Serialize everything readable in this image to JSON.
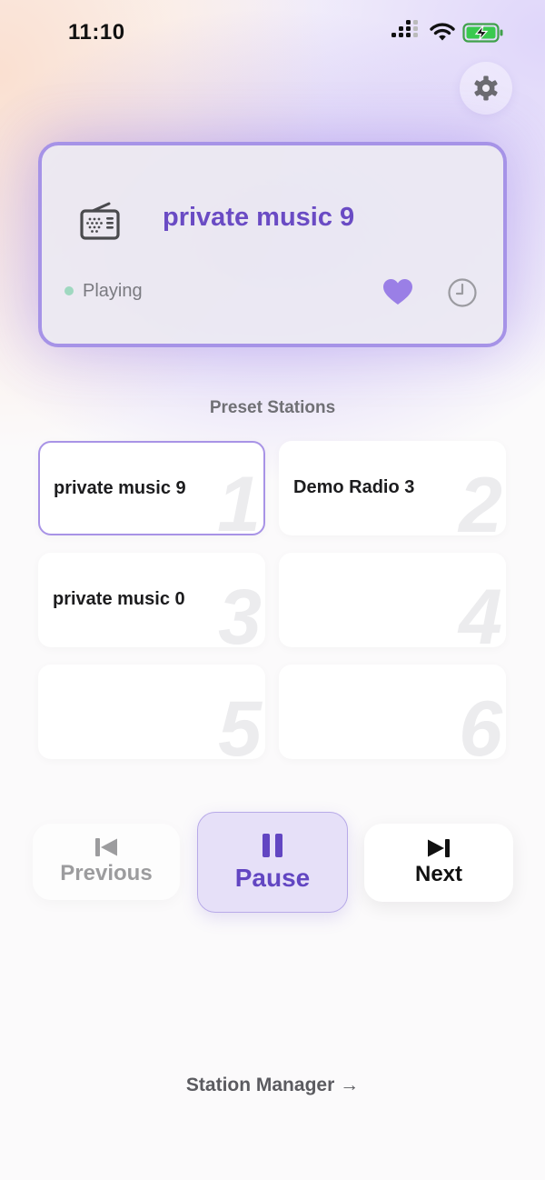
{
  "status_bar": {
    "time": "11:10"
  },
  "now_playing": {
    "station": "private music 9",
    "status": "Playing",
    "status_color": "#9fd8c0",
    "accent_color": "#6a4bc4",
    "icons": [
      "radio-icon",
      "heart-icon",
      "history-icon"
    ]
  },
  "presets": {
    "heading": "Preset Stations",
    "items": [
      {
        "number": "1",
        "name": "private music 9",
        "active": true
      },
      {
        "number": "2",
        "name": "Demo Radio 3",
        "active": false
      },
      {
        "number": "3",
        "name": "private music 0",
        "active": false
      },
      {
        "number": "4",
        "name": "",
        "active": false
      },
      {
        "number": "5",
        "name": "",
        "active": false
      },
      {
        "number": "6",
        "name": "",
        "active": false
      }
    ]
  },
  "controls": {
    "previous_label": "Previous",
    "pause_label": "Pause",
    "next_label": "Next"
  },
  "footer": {
    "station_manager_link": "Station Manager →"
  }
}
